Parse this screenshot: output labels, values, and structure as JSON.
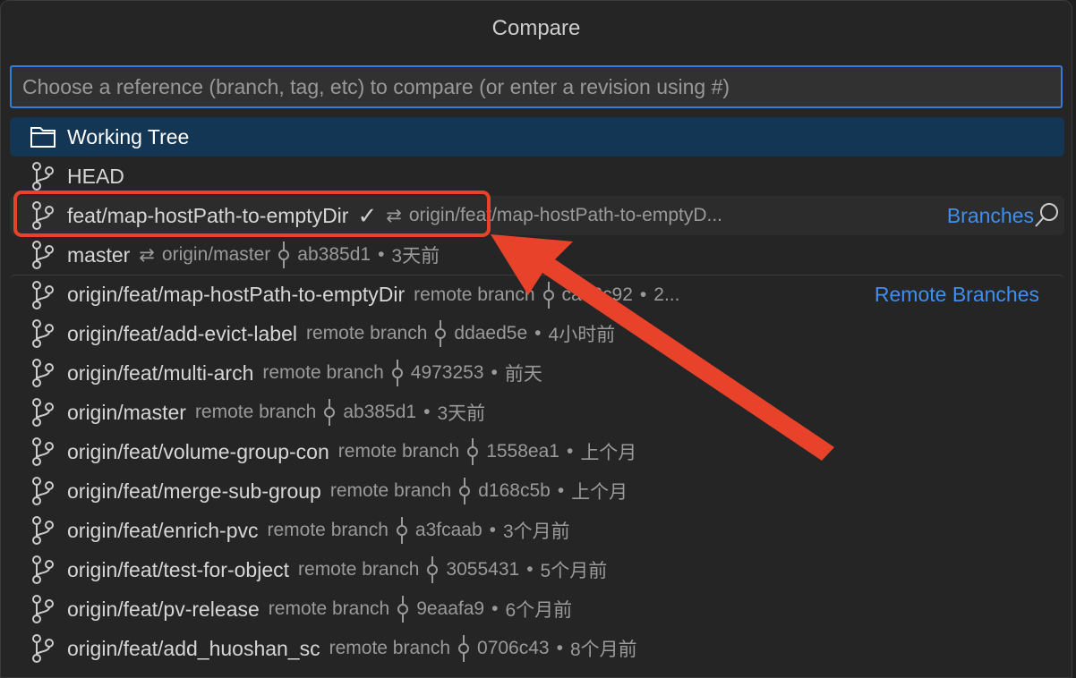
{
  "title": "Compare",
  "input": {
    "placeholder": "Choose a reference (branch, tag, etc) to compare (or enter a revision using #)"
  },
  "items": [
    {
      "icon": "folder-icon",
      "name": "Working Tree"
    },
    {
      "icon": "branch-icon",
      "name": "HEAD"
    },
    {
      "icon": "branch-icon",
      "name": "feat/map-hostPath-to-emptyDir",
      "check": "✓",
      "sync": "⇄",
      "upstream": "origin/feat/map-hostPath-to-emptyD...",
      "group": "Branches"
    },
    {
      "icon": "branch-icon",
      "name": "master",
      "sync": "⇄",
      "upstream": "origin/master",
      "sha": "ab385d1",
      "date": "3天前"
    },
    {
      "icon": "branch-icon",
      "name": "origin/feat/map-hostPath-to-emptyDir",
      "kind": "remote branch",
      "sha": "ca76c92",
      "date": "2...",
      "group": "Remote Branches"
    },
    {
      "icon": "branch-icon",
      "name": "origin/feat/add-evict-label",
      "kind": "remote branch",
      "sha": "ddaed5e",
      "date": "4小时前"
    },
    {
      "icon": "branch-icon",
      "name": "origin/feat/multi-arch",
      "kind": "remote branch",
      "sha": "4973253",
      "date": "前天"
    },
    {
      "icon": "branch-icon",
      "name": "origin/master",
      "kind": "remote branch",
      "sha": "ab385d1",
      "date": "3天前"
    },
    {
      "icon": "branch-icon",
      "name": "origin/feat/volume-group-con",
      "kind": "remote branch",
      "sha": "1558ea1",
      "date": "上个月"
    },
    {
      "icon": "branch-icon",
      "name": "origin/feat/merge-sub-group",
      "kind": "remote branch",
      "sha": "d168c5b",
      "date": "上个月"
    },
    {
      "icon": "branch-icon",
      "name": "origin/feat/enrich-pvc",
      "kind": "remote branch",
      "sha": "a3fcaab",
      "date": "3个月前"
    },
    {
      "icon": "branch-icon",
      "name": "origin/feat/test-for-object",
      "kind": "remote branch",
      "sha": "3055431",
      "date": "5个月前"
    },
    {
      "icon": "branch-icon",
      "name": "origin/feat/pv-release",
      "kind": "remote branch",
      "sha": "9eaafa9",
      "date": "6个月前"
    },
    {
      "icon": "branch-icon",
      "name": "origin/feat/add_huoshan_sc",
      "kind": "remote branch",
      "sha": "0706c43",
      "date": "8个月前"
    }
  ],
  "colors": {
    "accent": "#3f8fef",
    "selection": "#143655",
    "annotation": "#e8432a"
  }
}
